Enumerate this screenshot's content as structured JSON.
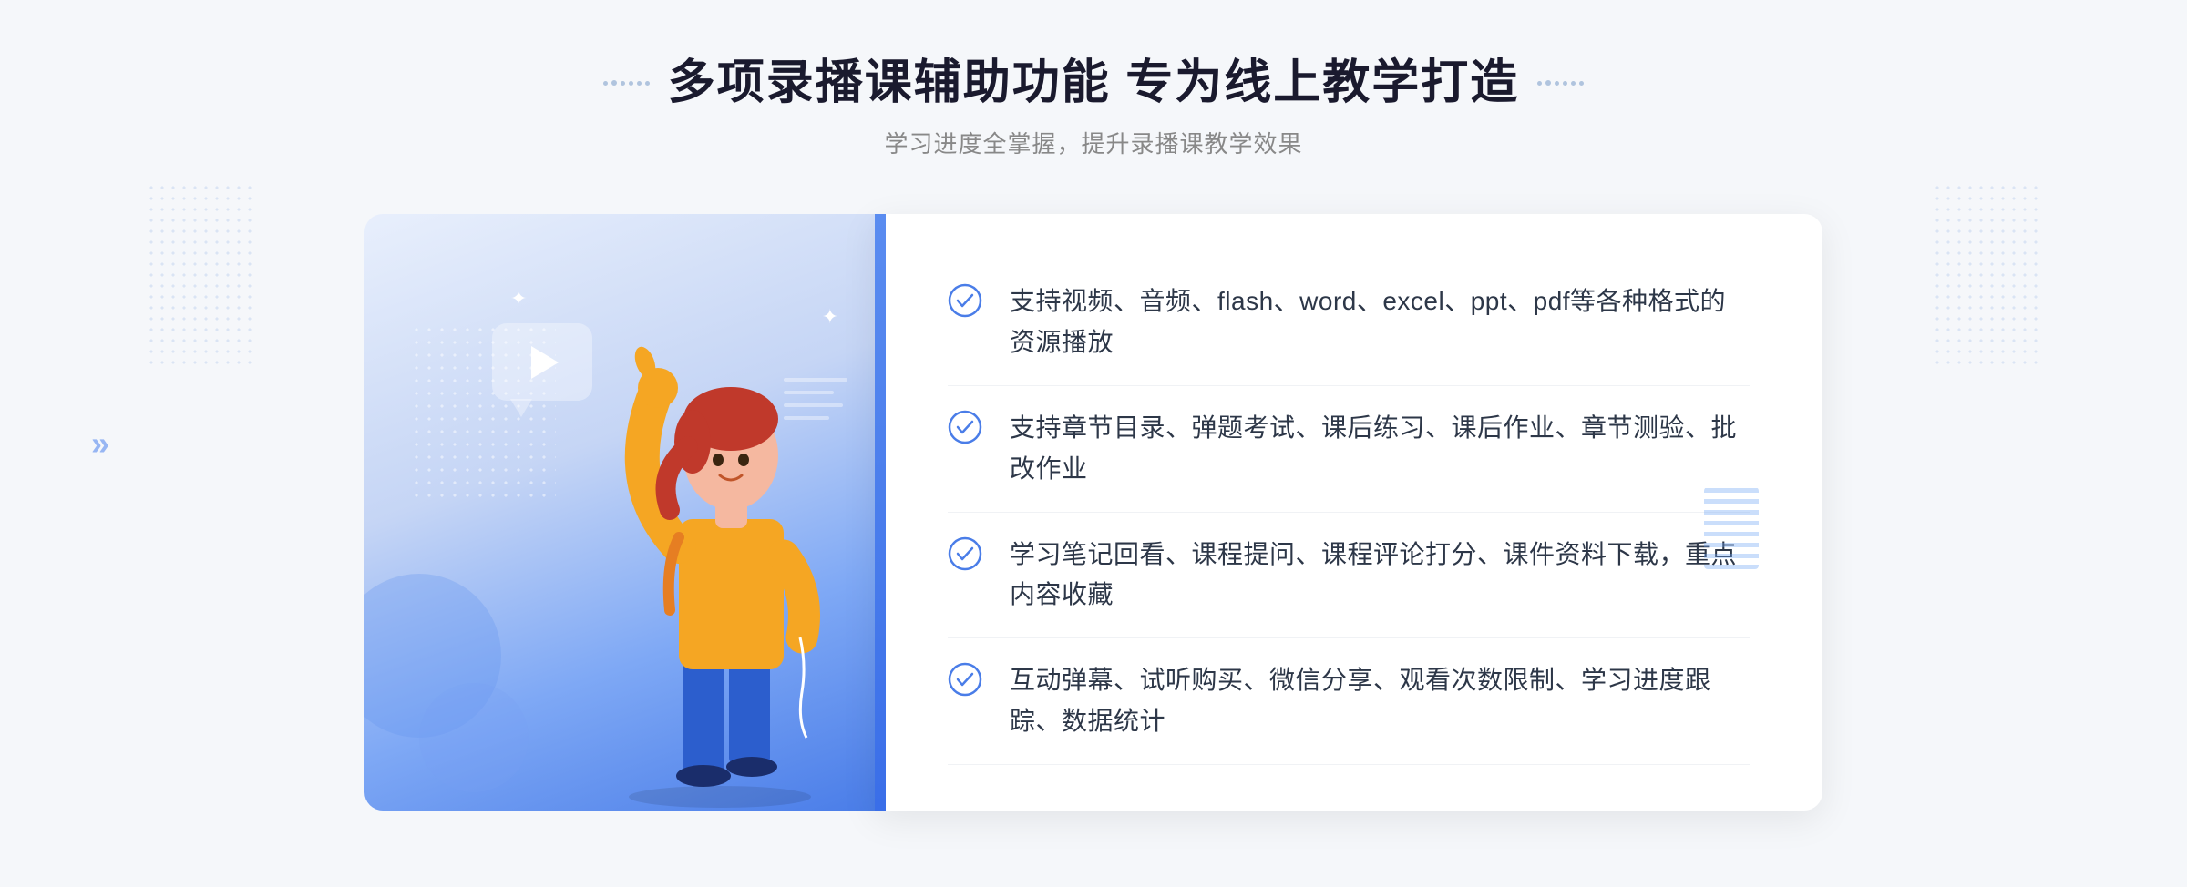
{
  "page": {
    "background_color": "#f5f7fb"
  },
  "header": {
    "title": "多项录播课辅助功能 专为线上教学打造",
    "subtitle": "学习进度全掌握，提升录播课教学效果",
    "decorator_left": "⁞⁞",
    "decorator_right": "⁞⁞"
  },
  "features": [
    {
      "id": 1,
      "text": "支持视频、音频、flash、word、excel、ppt、pdf等各种格式的资源播放"
    },
    {
      "id": 2,
      "text": "支持章节目录、弹题考试、课后练习、课后作业、章节测验、批改作业"
    },
    {
      "id": 3,
      "text": "学习笔记回看、课程提问、课程评论打分、课件资料下载，重点内容收藏"
    },
    {
      "id": 4,
      "text": "互动弹幕、试听购买、微信分享、观看次数限制、学习进度跟踪、数据统计"
    }
  ],
  "colors": {
    "primary_blue": "#4a7de8",
    "check_blue": "#4a7de8",
    "text_dark": "#2d3748",
    "text_gray": "#888888",
    "title_dark": "#1a1a2e"
  }
}
